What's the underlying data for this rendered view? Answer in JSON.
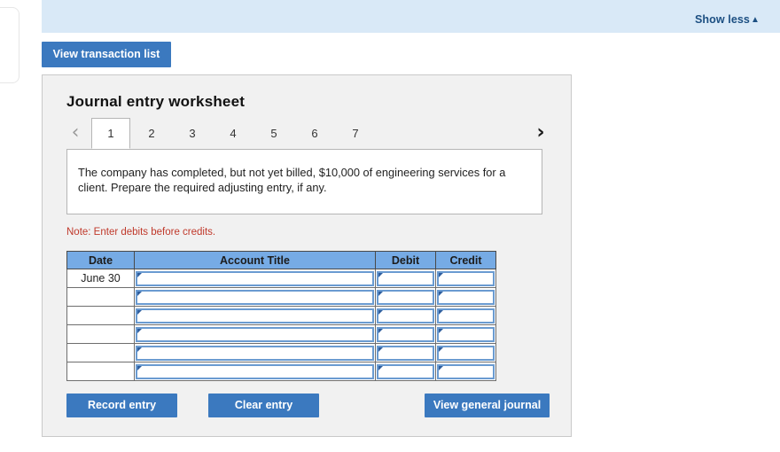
{
  "banner": {
    "show_less_label": "Show less",
    "show_less_caret": "▲",
    "background_color": "#d9e9f7",
    "link_color": "#1c4f82"
  },
  "toolbar": {
    "view_transaction_list_label": "View transaction list"
  },
  "worksheet": {
    "title": "Journal entry worksheet",
    "prev_icon": "‹",
    "next_icon": "›",
    "tabs": [
      {
        "label": "1",
        "active": true
      },
      {
        "label": "2",
        "active": false
      },
      {
        "label": "3",
        "active": false
      },
      {
        "label": "4",
        "active": false
      },
      {
        "label": "5",
        "active": false
      },
      {
        "label": "6",
        "active": false
      },
      {
        "label": "7",
        "active": false
      }
    ],
    "description": "The company has completed, but not yet billed, $10,000 of engineering services for a client. Prepare the required adjusting entry, if any.",
    "note": "Note: Enter debits before credits."
  },
  "table": {
    "headers": [
      "Date",
      "Account Title",
      "Debit",
      "Credit"
    ],
    "header_color": "#76abe5",
    "rows": [
      {
        "date": "June 30",
        "account_title": "",
        "debit": "",
        "credit": ""
      },
      {
        "date": "",
        "account_title": "",
        "debit": "",
        "credit": ""
      },
      {
        "date": "",
        "account_title": "",
        "debit": "",
        "credit": ""
      },
      {
        "date": "",
        "account_title": "",
        "debit": "",
        "credit": ""
      },
      {
        "date": "",
        "account_title": "",
        "debit": "",
        "credit": ""
      },
      {
        "date": "",
        "account_title": "",
        "debit": "",
        "credit": ""
      }
    ]
  },
  "actions": {
    "record_entry_label": "Record entry",
    "clear_entry_label": "Clear entry",
    "view_general_journal_label": "View general journal",
    "button_color": "#3b79bf"
  }
}
